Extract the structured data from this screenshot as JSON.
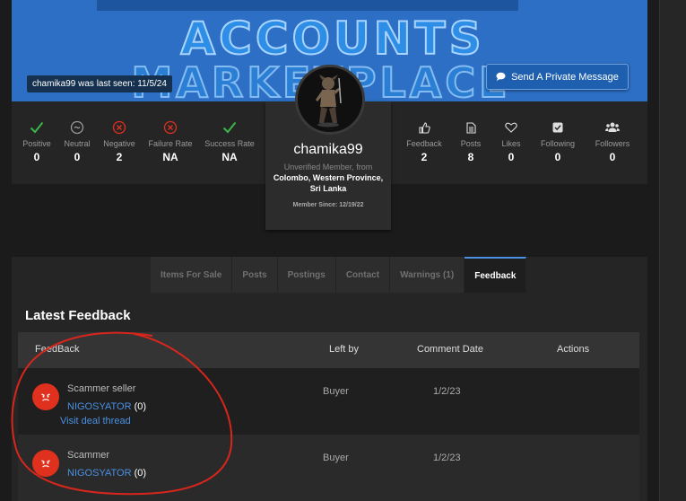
{
  "banner": {
    "line1": "ACCOUNTS",
    "line2": "MARKETPLACE",
    "last_seen": "chamika99 was last seen: 11/5/24",
    "pm_button": "Send A Private Message"
  },
  "ratings": [
    {
      "label": "Positive",
      "value": "0",
      "icon": "check-icon",
      "color": "#3bb54a"
    },
    {
      "label": "Neutral",
      "value": "0",
      "icon": "neutral-icon",
      "color": "#9a9a9a"
    },
    {
      "label": "Negative",
      "value": "2",
      "icon": "x-icon",
      "color": "#e0301e"
    },
    {
      "label": "Failure Rate",
      "value": "NA",
      "icon": "x-icon",
      "color": "#e0301e"
    },
    {
      "label": "Success Rate",
      "value": "NA",
      "icon": "check-icon",
      "color": "#3bb54a"
    }
  ],
  "activity": [
    {
      "label": "Feedback",
      "value": "2",
      "icon": "thumbs-up-icon"
    },
    {
      "label": "Posts",
      "value": "8",
      "icon": "document-icon"
    },
    {
      "label": "Likes",
      "value": "0",
      "icon": "heart-icon"
    },
    {
      "label": "Following",
      "value": "0",
      "icon": "check-square-icon"
    },
    {
      "label": "Followers",
      "value": "0",
      "icon": "users-icon"
    }
  ],
  "profile": {
    "username": "chamika99",
    "member_type": "Unverified Member, from",
    "location": "Colombo, Western Province, Sri Lanka",
    "since": "Member Since: 12/19/22"
  },
  "tabs": [
    "Items For Sale",
    "Posts",
    "Postings",
    "Contact",
    "Warnings (1)",
    "Feedback"
  ],
  "feedback": {
    "title": "Latest Feedback",
    "headers": [
      "FeedBack",
      "Left by",
      "Comment Date",
      "Actions"
    ],
    "rows": [
      {
        "comment": "Scammer seller",
        "user": "NIGOSYATOR",
        "count": "(0)",
        "link": "Visit deal thread",
        "left_by": "Buyer",
        "date": "1/2/23"
      },
      {
        "comment": "Scammer",
        "user": "NIGOSYATOR",
        "count": "(0)",
        "link": "",
        "left_by": "Buyer",
        "date": "1/2/23"
      }
    ]
  }
}
